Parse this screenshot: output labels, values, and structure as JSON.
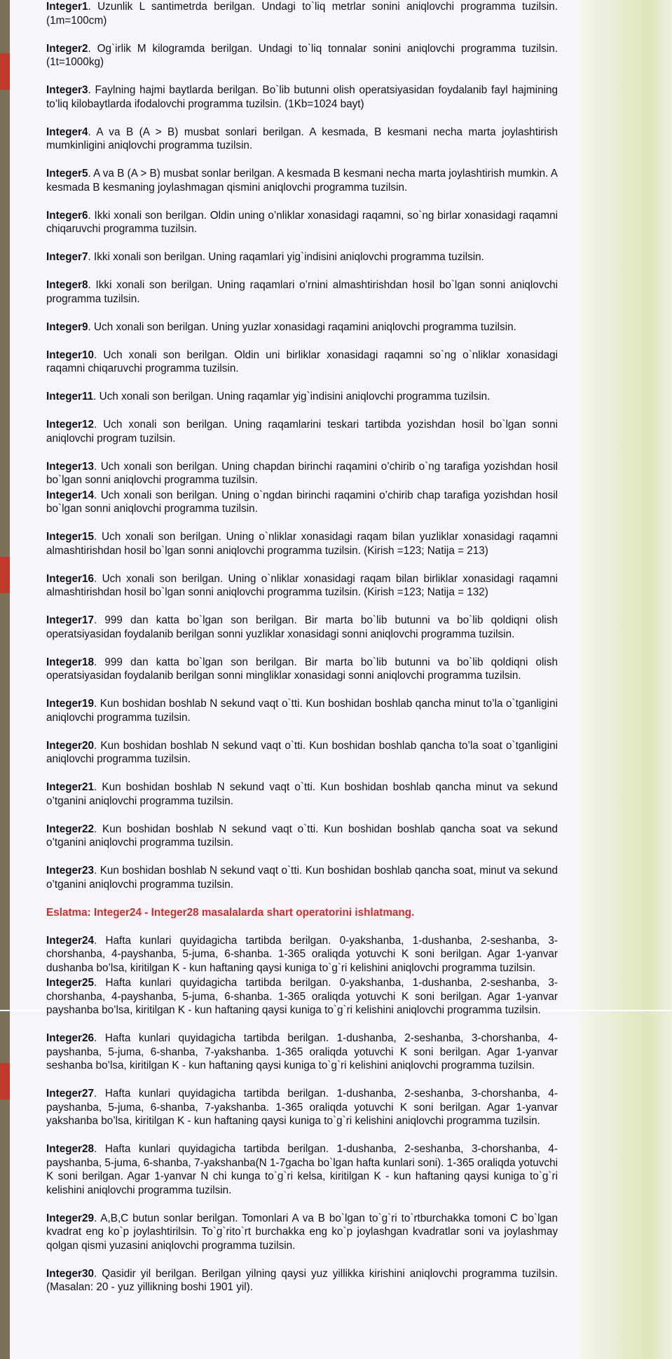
{
  "tasks": [
    {
      "id": "Integer1",
      "text": ". Uzunlik L santimetrda berilgan. Undagi to`liq metrlar sonini aniqlovchi programma tuzilsin. (1m=100cm)"
    },
    {
      "id": "Integer2",
      "text": ". Og`irlik M kilogramda berilgan. Undagi to`liq tonnalar sonini aniqlovchi programma tuzilsin. (1t=1000kg)"
    },
    {
      "id": "Integer3",
      "text": ". Faylning hajmi baytlarda berilgan. Bo`lib butunni olish operatsiyasidan foydalanib fayl hajmining to’liq kilobaytlarda ifodalovchi programma tuzilsin. (1Kb=1024 bayt)"
    },
    {
      "id": "Integer4",
      "text": ". A va B (A > B) musbat sonlari berilgan. A kesmada, B kesmani necha marta joylashtirish mumkinligini aniqlovchi programma tuzilsin."
    },
    {
      "id": "Integer5",
      "text": ". A va B (A > B) musbat sonlar berilgan. A kesmada B kesmani necha marta joylashtirish mumkin. A kesmada B kesmaning joylashmagan qismini aniqlovchi programma tuzilsin."
    },
    {
      "id": "Integer6",
      "text": ". Ikki xonali son berilgan. Oldin uning o’nliklar xonasidagi raqamni, so`ng birlar xonasidagi raqamni chiqaruvchi programma tuzilsin."
    },
    {
      "id": "Integer7",
      "text": ". Ikki xonali son berilgan. Uning raqamlari yig`indisini aniqlovchi programma tuzilsin."
    },
    {
      "id": "Integer8",
      "text": ". Ikki xonali son berilgan. Uning raqamlari o’rnini almashtirishdan hosil bo`lgan sonni aniqlovchi programma tuzilsin."
    },
    {
      "id": "Integer9",
      "text": ". Uch xonali son berilgan. Uning yuzlar xonasidagi raqamini aniqlovchi programma tuzilsin."
    },
    {
      "id": "Integer10",
      "text": ". Uch xonali son berilgan. Oldin uni birliklar xonasidagi raqamni so`ng o`nliklar xonasidagi raqamni chiqaruvchi programma tuzilsin."
    },
    {
      "id": "Integer11",
      "text": ". Uch xonali son berilgan. Uning raqamlar yig`indisini aniqlovchi programma tuzilsin."
    },
    {
      "id": "Integer12",
      "text": ". Uch xonali son berilgan. Uning raqamlarini teskari tartibda yozishdan hosil bo`lgan sonni aniqlovchi program tuzilsin."
    },
    {
      "id": "Integer13",
      "text": ". Uch xonali son berilgan. Uning chapdan birinchi raqamini o’chirib o`ng tarafiga yozishdan hosil bo`lgan sonni aniqlovchi programma tuzilsin."
    },
    {
      "id": "Integer14",
      "text": ". Uch xonali son berilgan. Uning o`ngdan birinchi raqamini o’chirib chap tarafiga yozishdan hosil bo`lgan sonni aniqlovchi programma tuzilsin."
    },
    {
      "id": "Integer15",
      "text": ". Uch xonali son berilgan. Uning o`nliklar xonasidagi raqam bilan yuzliklar xonasidagi raqamni almashtirishdan hosil bo`lgan sonni aniqlovchi programma tuzilsin. (Kirish =123;  Natija = 213)"
    },
    {
      "id": "Integer16",
      "text": ". Uch xonali son berilgan. Uning o`nliklar xonasidagi raqam bilan birliklar xonasidagi raqamni almashtirishdan hosil bo`lgan sonni aniqlovchi programma tuzilsin. (Kirish =123; Natija = 132)"
    },
    {
      "id": "Integer17",
      "text": ". 999 dan katta bo`lgan son berilgan. Bir marta bo`lib butunni va bo`lib qoldiqni olish operatsiyasidan foydalanib berilgan sonni yuzliklar xonasidagi sonni aniqlovchi programma tuzilsin."
    },
    {
      "id": "Integer18",
      "text": ". 999 dan katta bo`lgan son berilgan. Bir marta bo`lib butunni va bo`lib qoldiqni olish operatsiyasidan foydalanib berilgan sonni mingliklar xonasidagi sonni aniqlovchi programma tuzilsin."
    },
    {
      "id": "Integer19",
      "text": ". Kun boshidan boshlab N sekund vaqt o`tti. Kun boshidan boshlab qancha minut to’la o`tganligini aniqlovchi programma tuzilsin."
    },
    {
      "id": "Integer20",
      "text": ". Kun boshidan boshlab N sekund vaqt o`tti. Kun boshidan boshlab qancha to’la soat o`tganligini aniqlovchi programma tuzilsin."
    },
    {
      "id": "Integer21",
      "text": ". Kun boshidan boshlab N sekund vaqt o`tti. Kun boshidan boshlab qancha minut va sekund o’tganini aniqlovchi programma tuzilsin."
    },
    {
      "id": "Integer22",
      "text": ". Kun boshidan boshlab N sekund vaqt o`tti. Kun boshidan boshlab qancha soat va sekund o’tganini aniqlovchi programma tuzilsin."
    },
    {
      "id": "Integer23",
      "text": ". Kun boshidan boshlab N sekund vaqt o`tti. Kun boshidan boshlab qancha soat, minut va sekund o’tganini aniqlovchi programma tuzilsin."
    }
  ],
  "note": "Eslatma: Integer24 - Integer28 masalalarda shart operatorini ishlatmang.",
  "tasks2": [
    {
      "id": "Integer24",
      "text": ". Hafta kunlari quyidagicha tartibda berilgan. 0-yakshanba, 1-dushanba, 2-seshanba, 3-chorshanba, 4-payshanba, 5-juma, 6-shanba. 1-365 oraliqda yotuvchi K soni berilgan. Agar 1-yanvar dushanba bo’lsa, kiritilgan K - kun haftaning qaysi kuniga to`g`ri kelishini aniqlovchi programma tuzilsin."
    },
    {
      "id": "Integer25",
      "text": ". Hafta kunlari quyidagicha tartibda berilgan. 0-yakshanba, 1-dushanba, 2-seshanba, 3-chorshanba, 4-payshanba, 5-juma, 6-shanba. 1-365 oraliqda yotuvchi K soni berilgan. Agar 1-yanvar payshanba bo’lsa, kiritilgan K - kun haftaning qaysi kuniga to`g`ri kelishini aniqlovchi programma tuzilsin."
    },
    {
      "id": "Integer26",
      "text": ". Hafta kunlari quyidagicha tartibda berilgan. 1-dushanba, 2-seshanba, 3-chorshanba, 4-payshanba, 5-juma, 6-shanba, 7-yakshanba. 1-365 oraliqda yotuvchi K soni berilgan. Agar 1-yanvar seshanba bo’lsa, kiritilgan K - kun haftaning qaysi kuniga to`g`ri kelishini aniqlovchi programma tuzilsin."
    },
    {
      "id": "Integer27",
      "text": ". Hafta kunlari quyidagicha tartibda berilgan. 1-dushanba, 2-seshanba, 3-chorshanba, 4-payshanba, 5-juma, 6-shanba, 7-yakshanba. 1-365 oraliqda yotuvchi K soni berilgan. Agar 1-yanvar yakshanba bo’lsa, kiritilgan K - kun haftaning qaysi kuniga to`g`ri kelishini aniqlovchi programma tuzilsin."
    },
    {
      "id": "Integer28",
      "text": ". Hafta kunlari quyidagicha tartibda berilgan. 1-dushanba, 2-seshanba, 3-chorshanba, 4-payshanba, 5-juma, 6-shanba, 7-yakshanba(N 1-7gacha bo`lgan hafta kunlari soni). 1-365 oraliqda yotuvchi K soni berilgan. Agar 1-yanvar N chi kunga to`g`ri kelsa, kiritilgan K - kun haftaning qaysi kuniga to`g`ri kelishini aniqlovchi programma tuzilsin."
    },
    {
      "id": "Integer29",
      "text": ". A,B,C butun sonlar berilgan. Tomonlari A va B bo`lgan to`g`ri to`rtburchakka tomoni C bo`lgan kvadrat eng ko`p joylashtirilsin. To`g`rito`rt burchakka eng ko`p joylashgan kvadratlar soni va joylashmay qolgan qismi yuzasini aniqlovchi programma tuzilsin."
    },
    {
      "id": "Integer30",
      "text": ". Qasidir yil berilgan. Berilgan yilning qaysi yuz yillikka kirishini aniqlovchi programma tuzilsin. (Masalan: 20 - yuz yillikning boshi 1901 yil)."
    }
  ]
}
